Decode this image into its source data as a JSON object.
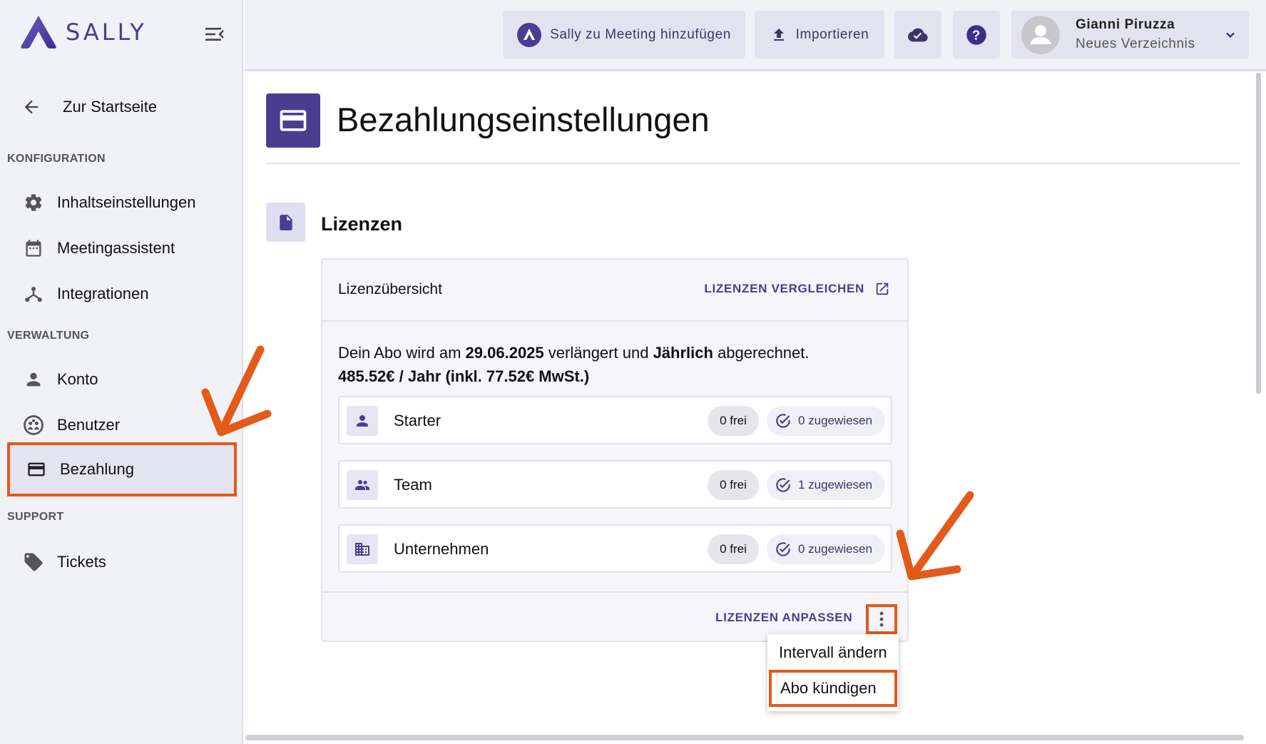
{
  "app": {
    "logo_text": "SALLY"
  },
  "colors": {
    "brand": "#4a3d8f",
    "annotation": "#e35a1a",
    "sidebar_bg": "#f1f1f8"
  },
  "sidebar": {
    "back_label": "Zur Startseite",
    "sections": {
      "config": "KONFIGURATION",
      "admin": "VERWALTUNG",
      "support": "SUPPORT"
    },
    "items": [
      {
        "label": "Inhaltseinstellungen",
        "icon": "gear-icon"
      },
      {
        "label": "Meetingassistent",
        "icon": "calendar-icon"
      },
      {
        "label": "Integrationen",
        "icon": "hub-icon"
      },
      {
        "label": "Konto",
        "icon": "person-icon"
      },
      {
        "label": "Benutzer",
        "icon": "group-icon"
      },
      {
        "label": "Bezahlung",
        "icon": "credit-card-icon",
        "active": true
      },
      {
        "label": "Tickets",
        "icon": "tag-icon"
      }
    ]
  },
  "topbar": {
    "add_to_meeting": "Sally zu Meeting hinzufügen",
    "import": "Importieren",
    "user": {
      "name": "Gianni Piruzza",
      "directory": "Neues Verzeichnis"
    }
  },
  "main": {
    "page_title": "Bezahlungseinstellungen",
    "section_title": "Lizenzen",
    "card": {
      "title": "Lizenzübersicht",
      "compare_link": "LIZENZEN VERGLEICHEN",
      "info": {
        "prefix": "Dein Abo wird am",
        "date": "29.06.2025",
        "middle": "verlängert und",
        "interval": "Jährlich",
        "suffix": "abgerechnet.",
        "price": "485.52€ / Jahr (inkl. 77.52€ MwSt.)"
      },
      "licenses": [
        {
          "name": "Starter",
          "free": "0 frei",
          "assigned": "0 zugewiesen",
          "icon": "person-icon"
        },
        {
          "name": "Team",
          "free": "0 frei",
          "assigned": "1 zugewiesen",
          "icon": "group-icon"
        },
        {
          "name": "Unternehmen",
          "free": "0 frei",
          "assigned": "0 zugewiesen",
          "icon": "building-icon"
        }
      ],
      "adjust_link": "LIZENZEN ANPASSEN"
    },
    "menu": {
      "change_interval": "Intervall ändern",
      "cancel_subscription": "Abo kündigen"
    }
  }
}
